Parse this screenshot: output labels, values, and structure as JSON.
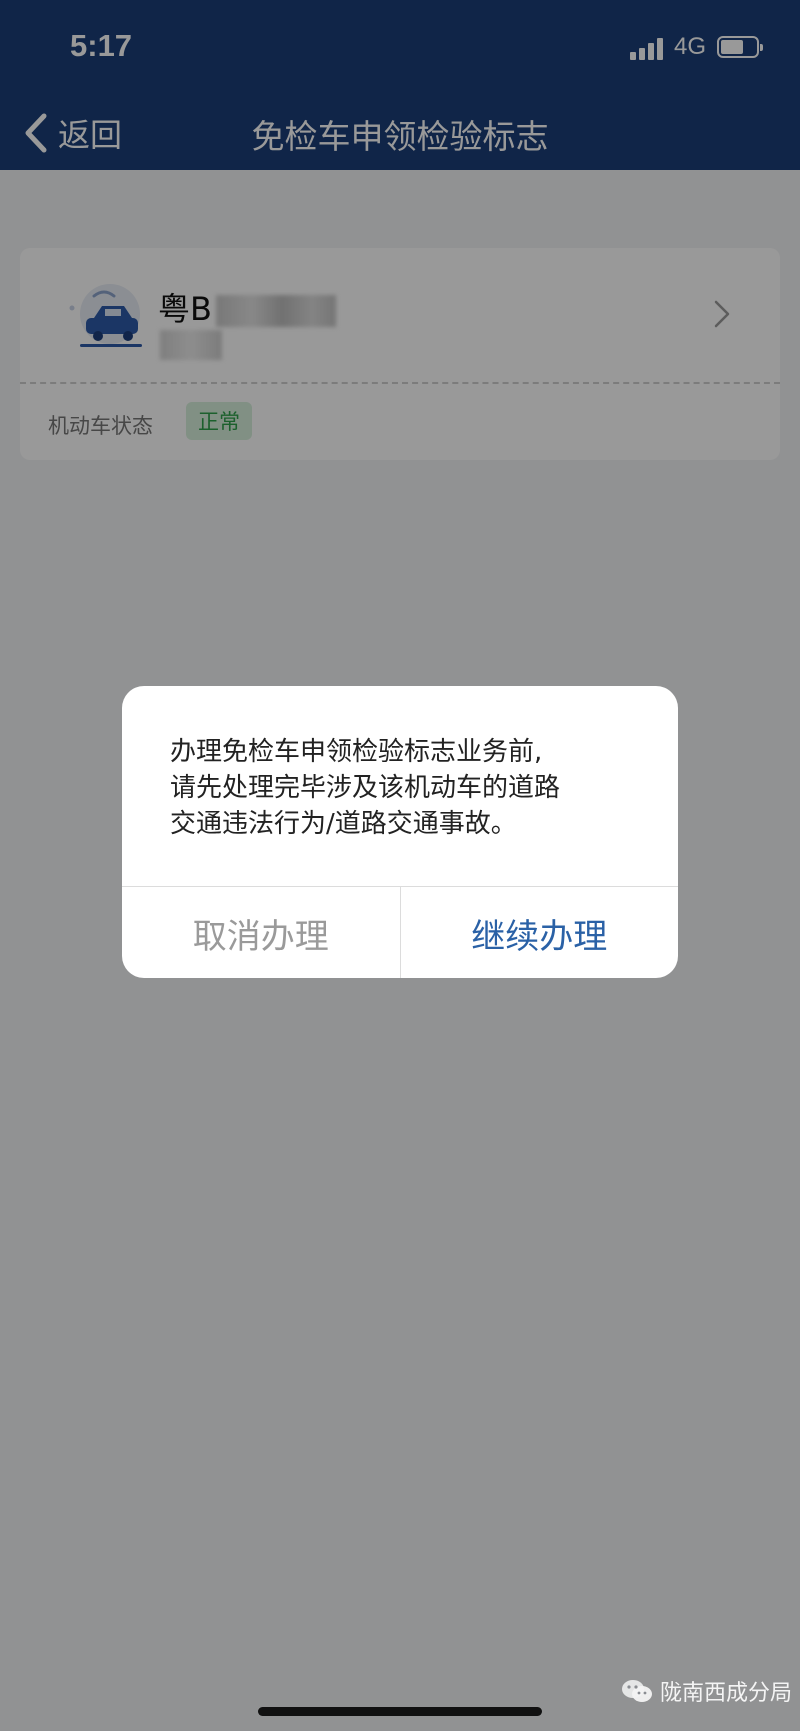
{
  "status_bar": {
    "time": "5:17",
    "network": "4G"
  },
  "nav": {
    "back_label": "返回",
    "title": "免检车申领检验标志"
  },
  "vehicle_card": {
    "plate": "粤B",
    "status_label": "机动车状态",
    "status_value": "正常"
  },
  "dialog": {
    "message_lines": [
      "办理免检车申领检验标志业务前,",
      "请先处理完毕涉及该机动车的道路",
      "交通违法行为/道路交通事故。"
    ],
    "cancel_label": "取消办理",
    "confirm_label": "继续办理"
  },
  "watermark": {
    "text": "陇南西成分局"
  },
  "colors": {
    "header": "#1b3f78",
    "accent": "#2a61a6",
    "badge_text": "#2fa14c"
  },
  "icons": [
    "back-chevron-icon",
    "car-charging-icon",
    "chevron-right-icon",
    "wechat-icon"
  ]
}
